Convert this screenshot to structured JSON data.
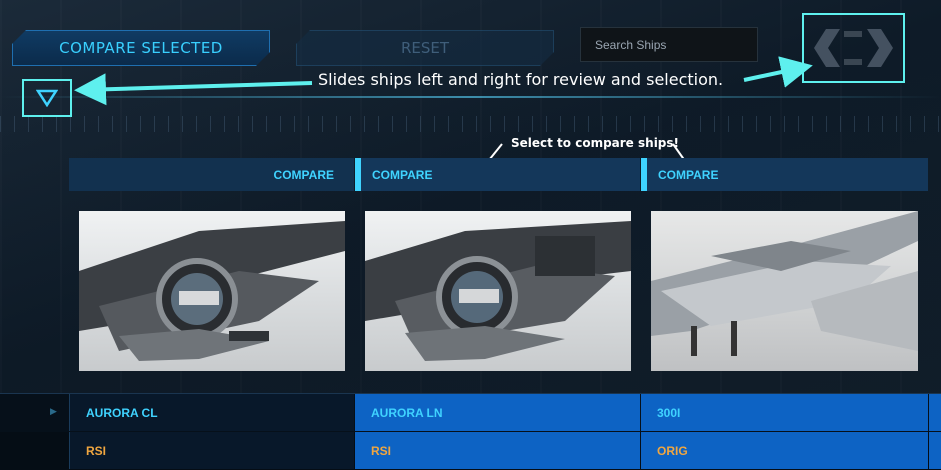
{
  "toolbar": {
    "compare_selected_label": "COMPARE SELECTED",
    "reset_label": "RESET",
    "search_placeholder": "Search Ships"
  },
  "annotations": {
    "slider_note": "Slides ships left and right for review and selection.",
    "compare_note": "Select to compare ships!"
  },
  "compare_headers": [
    "COMPARE",
    "COMPARE",
    "COMPARE"
  ],
  "ships": [
    {
      "name": "AURORA CL",
      "manufacturer": "RSI"
    },
    {
      "name": "AURORA LN",
      "manufacturer": "RSI"
    },
    {
      "name": "300I",
      "manufacturer": "ORIG"
    }
  ],
  "colors": {
    "accent": "#3fd3ff",
    "annotation": "#5ef0ee",
    "selected_column": "#0d63c4",
    "manufacturer_text": "#f0a640"
  },
  "icons": {
    "slider": "chevron-left-right-icon",
    "toggle": "triangle-down-icon"
  }
}
